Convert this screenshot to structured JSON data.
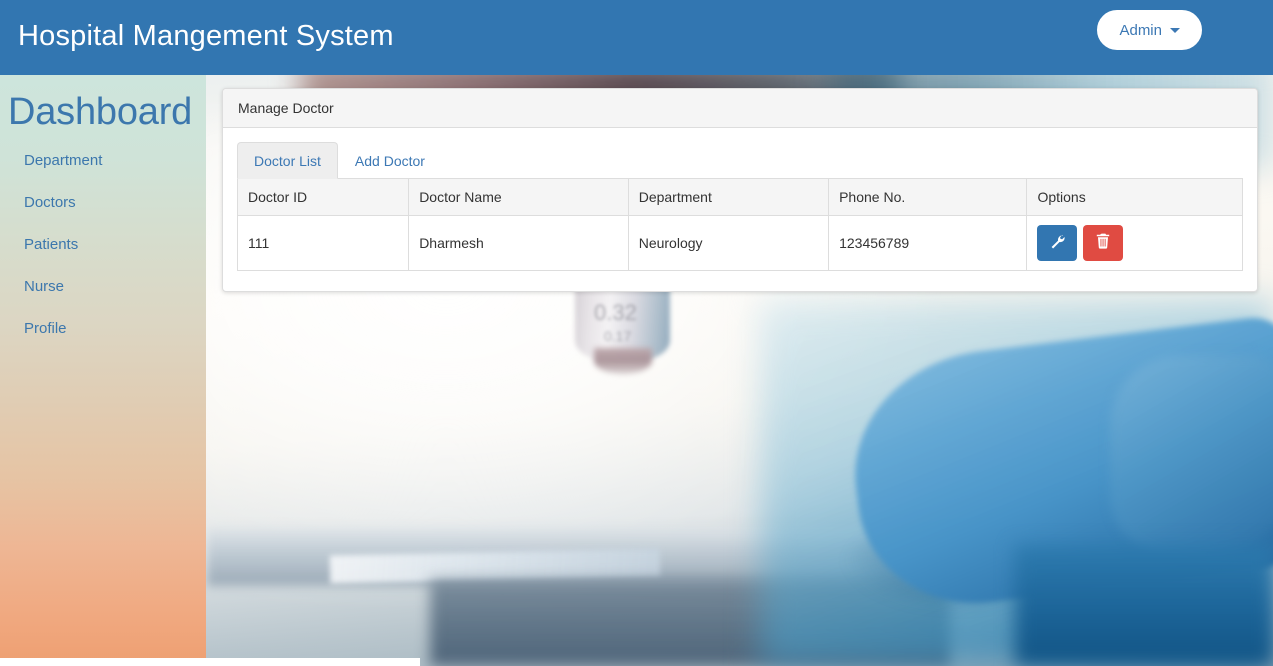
{
  "navbar": {
    "brand": "Hospital Mangement System",
    "admin_label": "Admin",
    "caret_icon": "caret-down-icon",
    "bg_color": "#3276b1",
    "brand_color": "#ffffff",
    "admin_text_color": "#3c78b4"
  },
  "sidebar": {
    "title": "Dashboard",
    "title_color": "#3c77ad",
    "link_color": "#3c77ad",
    "gradient_top": "#cde5dc",
    "gradient_bottom": "#ee9f71",
    "items": [
      {
        "label": "Department"
      },
      {
        "label": "Doctors"
      },
      {
        "label": "Patients"
      },
      {
        "label": "Nurse"
      },
      {
        "label": "Profile"
      }
    ]
  },
  "panel": {
    "heading": "Manage Doctor",
    "heading_bg": "#f5f5f5",
    "border_color": "#dddddd"
  },
  "tabs": [
    {
      "label": "Doctor List",
      "active": true
    },
    {
      "label": "Add Doctor",
      "active": false
    }
  ],
  "table": {
    "columns": [
      "Doctor ID",
      "Doctor Name",
      "Department",
      "Phone No.",
      "Options"
    ],
    "rows": [
      {
        "doctor_id": "111",
        "doctor_name": "Dharmesh",
        "department": "Neurology",
        "phone": "123456789",
        "actions": [
          {
            "name": "wrench-icon",
            "title": "Edit",
            "color": "#3276b1"
          },
          {
            "name": "trash-icon",
            "title": "Delete",
            "color": "#e04b42"
          }
        ]
      }
    ]
  },
  "background": {
    "description": "blurred laboratory photo: microscope objective over a slide with a blue-gloved finger at right",
    "lens_markings_line1": "0.32",
    "lens_markings_line2": "0.17"
  },
  "scrollbar": {
    "orientation": "horizontal",
    "thumb_color": "#ffffff"
  }
}
